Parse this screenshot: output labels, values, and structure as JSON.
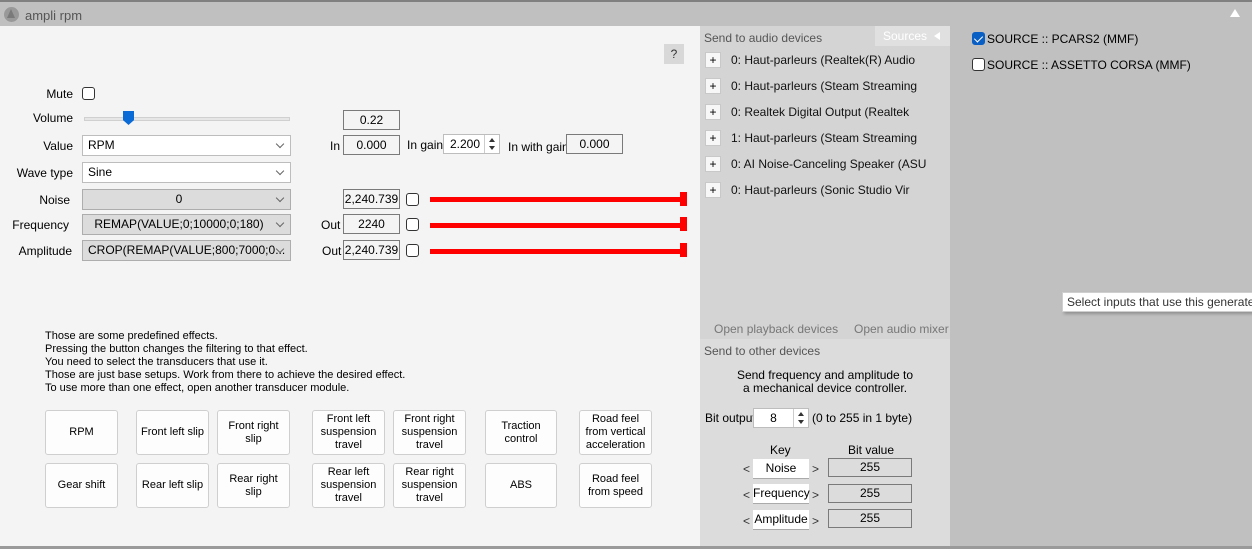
{
  "window": {
    "title": "ampli rpm",
    "collapse_icon": "triangle-up-icon"
  },
  "help_button": "?",
  "controls": {
    "mute_label": "Mute",
    "mute_checked": false,
    "volume_label": "Volume",
    "volume_fraction": 0.22,
    "volume_display": "0.22",
    "value_label": "Value",
    "value_selected": "RPM",
    "wave_type_label": "Wave type",
    "wave_type_selected": "Sine",
    "noise_label": "Noise",
    "noise_selected": "0",
    "frequency_label": "Frequency",
    "frequency_selected": "REMAP(VALUE;0;10000;0;180)",
    "amplitude_label": "Amplitude",
    "amplitude_selected": "CROP(REMAP(VALUE;800;7000;0...",
    "in_label": "In",
    "in_value": "0.000",
    "in_gain_label": "In gain",
    "in_gain_value": "2.200",
    "in_with_gain_label": "In with gain",
    "in_with_gain_value": "0.000",
    "noise_out_value": "2,240.739",
    "frequency_out_label": "Out",
    "frequency_out_value": "2240",
    "amplitude_out_label": "Out",
    "amplitude_out_value": "2,240.739",
    "noise_check": false,
    "frequency_check": false,
    "amplitude_check": false,
    "noise_bar_fraction": 1.0,
    "frequency_bar_fraction": 1.0,
    "amplitude_bar_fraction": 1.0,
    "bar_color": "#ff0000"
  },
  "description": [
    "Those are some predefined effects.",
    "Pressing the button changes the filtering to that effect.",
    "You need to select the transducers that use it.",
    "Those are just base setups. Work from there to achieve the desired effect.",
    "To use more than one effect, open another transducer module."
  ],
  "effects": {
    "row1": [
      "RPM",
      "Front left slip",
      "Front right slip",
      "Front left suspension travel",
      "Front right suspension travel",
      "Traction control",
      "Road feel from vertical acceleration"
    ],
    "row2": [
      "Gear shift",
      "Rear left slip",
      "Rear right slip",
      "Rear left suspension travel",
      "Rear right suspension travel",
      "ABS",
      "Road feel from speed"
    ]
  },
  "audio": {
    "header": "Send to audio devices",
    "sources_tab": "Sources",
    "add_symbol": "+",
    "devices": [
      "0: Haut-parleurs (Realtek(R) Audio",
      "0: Haut-parleurs (Steam Streaming",
      "0: Realtek Digital Output (Realtek",
      "1: Haut-parleurs (Steam Streaming",
      "0: AI Noise-Canceling Speaker (ASU",
      "0: Haut-parleurs (Sonic Studio Vir"
    ],
    "open_playback": "Open playback devices",
    "open_mixer": "Open audio mixer"
  },
  "other": {
    "header": "Send to other devices",
    "info_line1": "Send frequency and amplitude to",
    "info_line2": "a mechanical device controller.",
    "bit_output_label": "Bit output",
    "bit_output_value": "8",
    "bit_output_hint": "(0 to 255 in 1 byte)",
    "key_header": "Key",
    "bit_value_header": "Bit value",
    "prev": "<",
    "next": ">",
    "rows": [
      {
        "key": "Noise",
        "value": "255"
      },
      {
        "key": "Frequency",
        "value": "255"
      },
      {
        "key": "Amplitude",
        "value": "255"
      }
    ]
  },
  "sources": {
    "items": [
      {
        "label": "SOURCE :: PCARS2 (MMF)",
        "checked": true
      },
      {
        "label": "SOURCE :: ASSETTO CORSA (MMF)",
        "checked": false
      }
    ],
    "tooltip": "Select inputs that use this generated"
  }
}
